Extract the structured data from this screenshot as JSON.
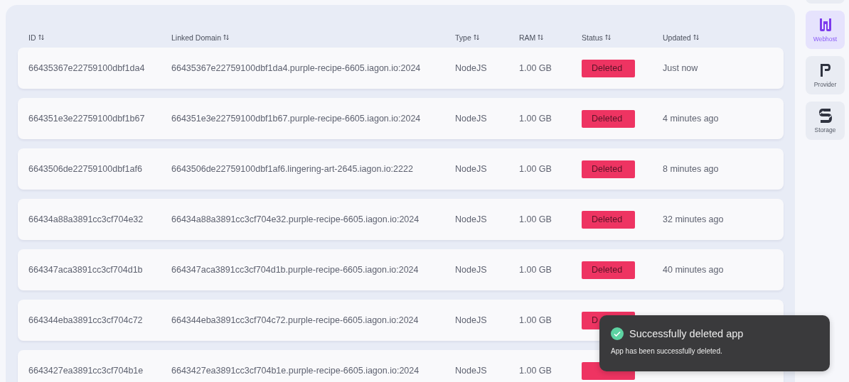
{
  "table": {
    "columns": [
      "ID",
      "Linked Domain",
      "Type",
      "RAM",
      "Status",
      "Updated"
    ],
    "rows": [
      {
        "id": "66435367e22759100dbf1da4",
        "domain": "66435367e22759100dbf1da4.purple-recipe-6605.iagon.io:2024",
        "type": "NodeJS",
        "ram": "1.00 GB",
        "status": "Deleted",
        "updated": "Just now"
      },
      {
        "id": "664351e3e22759100dbf1b67",
        "domain": "664351e3e22759100dbf1b67.purple-recipe-6605.iagon.io:2024",
        "type": "NodeJS",
        "ram": "1.00 GB",
        "status": "Deleted",
        "updated": "4 minutes ago"
      },
      {
        "id": "6643506de22759100dbf1af6",
        "domain": "6643506de22759100dbf1af6.lingering-art-2645.iagon.io:2222",
        "type": "NodeJS",
        "ram": "1.00 GB",
        "status": "Deleted",
        "updated": "8 minutes ago"
      },
      {
        "id": "66434a88a3891cc3cf704e32",
        "domain": "66434a88a3891cc3cf704e32.purple-recipe-6605.iagon.io:2024",
        "type": "NodeJS",
        "ram": "1.00 GB",
        "status": "Deleted",
        "updated": "32 minutes ago"
      },
      {
        "id": "664347aca3891cc3cf704d1b",
        "domain": "664347aca3891cc3cf704d1b.purple-recipe-6605.iagon.io:2024",
        "type": "NodeJS",
        "ram": "1.00 GB",
        "status": "Deleted",
        "updated": "40 minutes ago"
      },
      {
        "id": "664344eba3891cc3cf704c72",
        "domain": "664344eba3891cc3cf704c72.purple-recipe-6605.iagon.io:2024",
        "type": "NodeJS",
        "ram": "1.00 GB",
        "status": "D"
      },
      {
        "id": "6643427ea3891cc3cf704b1e",
        "domain": "6643427ea3891cc3cf704b1e.purple-recipe-6605.iagon.io:2024",
        "type": "NodeJS",
        "ram": "1.00 GB",
        "badge_only": true
      }
    ]
  },
  "sidebar": {
    "items": [
      {
        "kind": "blank"
      },
      {
        "kind": "webhost",
        "label": "Webhost",
        "selected": true
      },
      {
        "kind": "provider",
        "label": "Provider",
        "selected": false
      },
      {
        "kind": "storage",
        "label": "Storage",
        "selected": false
      }
    ]
  },
  "toast": {
    "title": "Successfully deleted app",
    "message": "App has been successfully deleted."
  }
}
